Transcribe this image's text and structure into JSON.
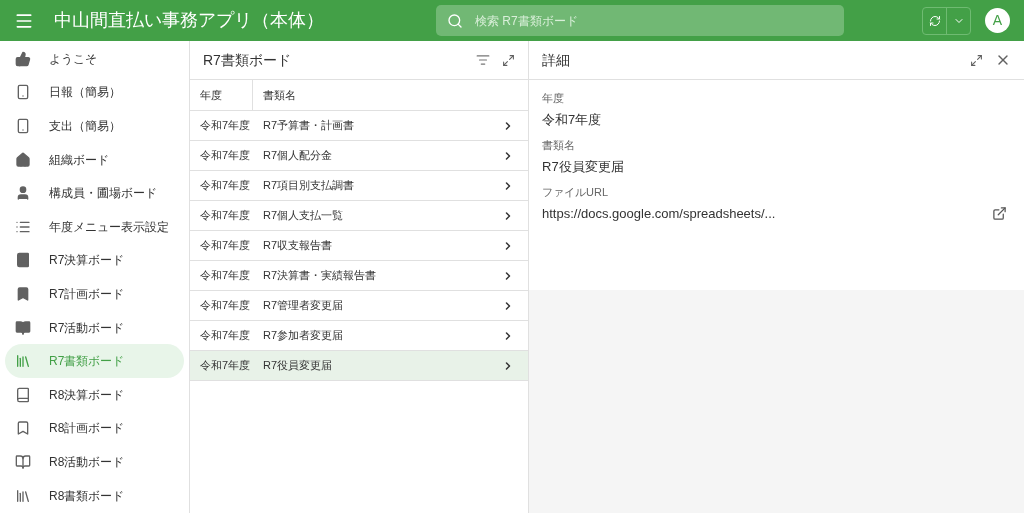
{
  "app_bar": {
    "title": "中山間直払い事務アプリ（本体）",
    "search": {
      "placeholder": "検索 R7書類ボード"
    },
    "avatar": "A"
  },
  "sidebar": {
    "items": [
      {
        "label": "ようこそ",
        "selected": false
      },
      {
        "label": "日報（簡易）",
        "selected": false
      },
      {
        "label": "支出（簡易）",
        "selected": false
      },
      {
        "label": "組織ボード",
        "selected": false
      },
      {
        "label": "構成員・圃場ボード",
        "selected": false
      },
      {
        "label": "年度メニュー表示設定",
        "selected": false
      },
      {
        "label": "R7決算ボード",
        "selected": false
      },
      {
        "label": "R7計画ボード",
        "selected": false
      },
      {
        "label": "R7活動ボード",
        "selected": false
      },
      {
        "label": "R7書類ボード",
        "selected": true
      },
      {
        "label": "R8決算ボード",
        "selected": false
      },
      {
        "label": "R8計画ボード",
        "selected": false
      },
      {
        "label": "R8活動ボード",
        "selected": false
      },
      {
        "label": "R8書類ボード",
        "selected": false
      }
    ]
  },
  "list": {
    "title": "R7書類ボード",
    "columns": [
      "年度",
      "書類名"
    ],
    "rows": [
      {
        "year": "令和7年度",
        "name": "R7予算書・計画書",
        "selected": false
      },
      {
        "year": "令和7年度",
        "name": "R7個人配分金",
        "selected": false
      },
      {
        "year": "令和7年度",
        "name": "R7項目別支払調書",
        "selected": false
      },
      {
        "year": "令和7年度",
        "name": "R7個人支払一覧",
        "selected": false
      },
      {
        "year": "令和7年度",
        "name": "R7収支報告書",
        "selected": false
      },
      {
        "year": "令和7年度",
        "name": "R7決算書・実績報告書",
        "selected": false
      },
      {
        "year": "令和7年度",
        "name": "R7管理者変更届",
        "selected": false
      },
      {
        "year": "令和7年度",
        "name": "R7参加者変更届",
        "selected": false
      },
      {
        "year": "令和7年度",
        "name": "R7役員変更届",
        "selected": true
      }
    ]
  },
  "detail": {
    "title": "詳細",
    "fields": [
      {
        "label": "年度",
        "value": "令和7年度",
        "kind": "text"
      },
      {
        "label": "書類名",
        "value": "R7役員変更届",
        "kind": "text"
      },
      {
        "label": "ファイルURL",
        "value": "https://docs.google.com/spreadsheets/...",
        "kind": "link"
      }
    ]
  }
}
